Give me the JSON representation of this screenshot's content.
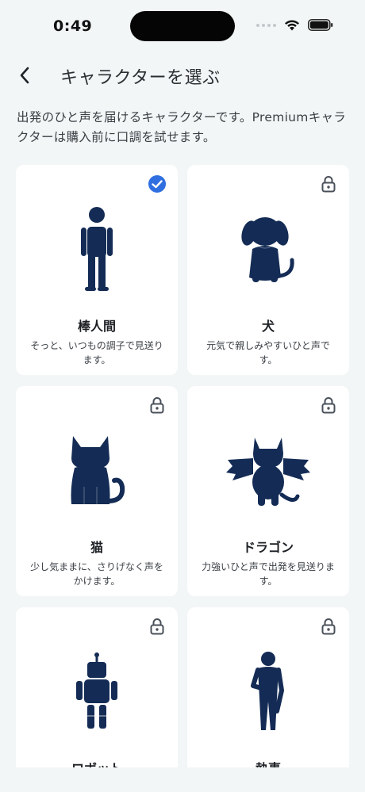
{
  "status_bar": {
    "time": "0:49"
  },
  "nav": {
    "title": "キャラクターを選ぶ"
  },
  "description": "出発のひと声を届けるキャラクターです。Premiumキャラクターは購入前に口調を試せます。",
  "cards": [
    {
      "name": "棒人間",
      "description": "そっと、いつもの調子で見送ります。",
      "selected": true,
      "locked": false,
      "icon": "stick-person-icon"
    },
    {
      "name": "犬",
      "description": "元気で親しみやすいひと声です。",
      "selected": false,
      "locked": true,
      "icon": "dog-icon"
    },
    {
      "name": "猫",
      "description": "少し気ままに、さりげなく声をかけます。",
      "selected": false,
      "locked": true,
      "icon": "cat-icon"
    },
    {
      "name": "ドラゴン",
      "description": "力強いひと声で出発を見送ります。",
      "selected": false,
      "locked": true,
      "icon": "dragon-icon"
    },
    {
      "name": "ロボット",
      "description": "",
      "selected": false,
      "locked": true,
      "icon": "robot-icon"
    },
    {
      "name": "執事",
      "description": "",
      "selected": false,
      "locked": true,
      "icon": "butler-icon"
    }
  ],
  "colors": {
    "figure": "#142c55",
    "accent": "#2f6fe0",
    "lock": "#4a505a"
  }
}
